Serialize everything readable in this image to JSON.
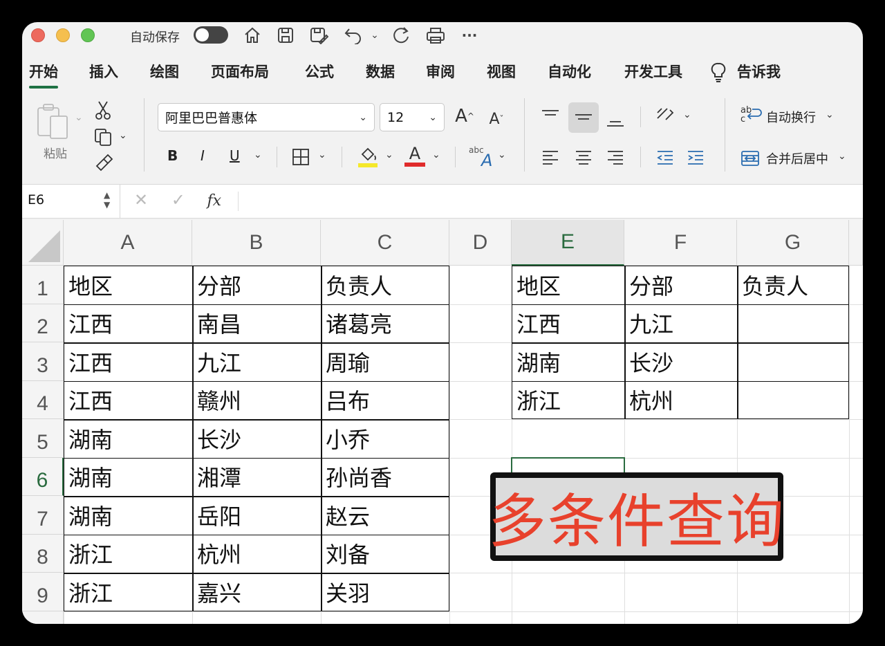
{
  "titlebar": {
    "autosave_label": "自动保存"
  },
  "tabs": [
    "开始",
    "插入",
    "绘图",
    "页面布局",
    "公式",
    "数据",
    "审阅",
    "视图",
    "自动化",
    "开发工具"
  ],
  "tell_me": "告诉我",
  "ribbon": {
    "paste_label": "粘贴",
    "font_name": "阿里巴巴普惠体",
    "font_size": "12",
    "bold": "B",
    "italic": "I",
    "underline": "U",
    "wrap_text": "自动换行",
    "merge_center": "合并后居中"
  },
  "formula_bar": {
    "name_box": "E6",
    "formula": ""
  },
  "sheet": {
    "columns": [
      "A",
      "B",
      "C",
      "D",
      "E",
      "F",
      "G"
    ],
    "rows": [
      "1",
      "2",
      "3",
      "4",
      "5",
      "6",
      "7",
      "8",
      "9"
    ],
    "table_left": [
      [
        "地区",
        "分部",
        "负责人"
      ],
      [
        "江西",
        "南昌",
        "诸葛亮"
      ],
      [
        "江西",
        "九江",
        "周瑜"
      ],
      [
        "江西",
        "赣州",
        "吕布"
      ],
      [
        "湖南",
        "长沙",
        "小乔"
      ],
      [
        "湖南",
        "湘潭",
        "孙尚香"
      ],
      [
        "湖南",
        "岳阳",
        "赵云"
      ],
      [
        "浙江",
        "杭州",
        "刘备"
      ],
      [
        "浙江",
        "嘉兴",
        "关羽"
      ]
    ],
    "table_right": [
      [
        "地区",
        "分部",
        "负责人"
      ],
      [
        "江西",
        "九江",
        ""
      ],
      [
        "湖南",
        "长沙",
        ""
      ],
      [
        "浙江",
        "杭州",
        ""
      ]
    ]
  },
  "banner_text": "多条件查询",
  "colors": {
    "accent": "#1f7244",
    "selection": "#2a6b3f",
    "banner_text": "#e8412c"
  }
}
